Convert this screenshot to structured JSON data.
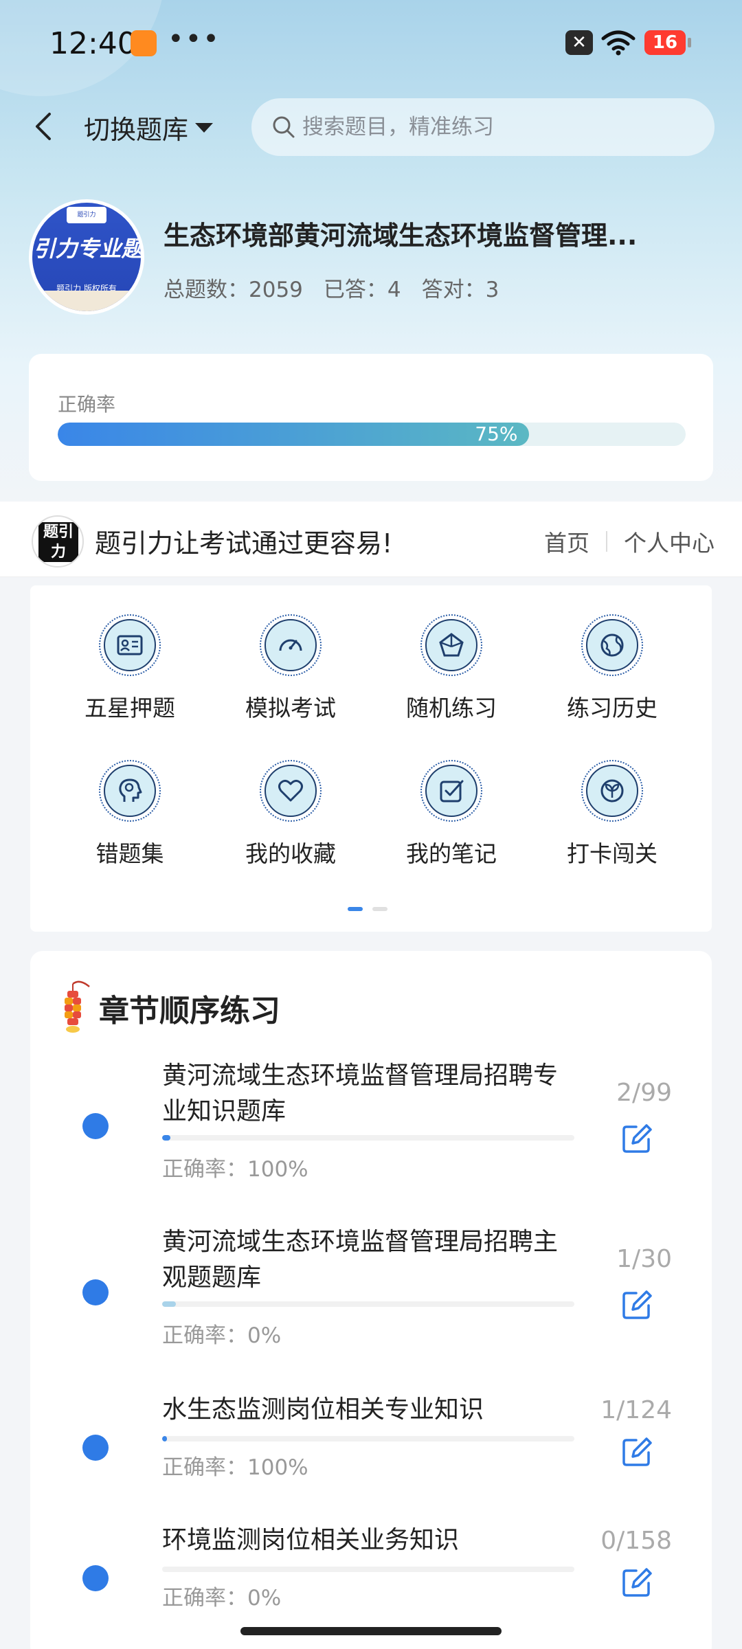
{
  "status_bar": {
    "time": "12:40",
    "battery": "16"
  },
  "header": {
    "switch_label": "切换题库",
    "search_placeholder": "搜索题目，精准练习"
  },
  "bank": {
    "logo_text": "引力专业题",
    "logo_top": "题引力",
    "logo_sub": "题引力 版权所有",
    "title": "生态环境部黄河流域生态环境监督管理...",
    "total_label": "总题数：",
    "total": "2059",
    "answered_label": "已答：",
    "answered": "4",
    "correct_label": "答对：",
    "correct": "3"
  },
  "accuracy": {
    "label": "正确率",
    "value_text": "75%",
    "value": 0.75
  },
  "banner": {
    "slogan": "题引力让考试通过更容易!",
    "logo_text": "题引力",
    "nav": [
      "首页",
      "个人中心"
    ]
  },
  "features": [
    {
      "label": "五星押题",
      "icon": "id-card-icon"
    },
    {
      "label": "模拟考试",
      "icon": "gauge-icon"
    },
    {
      "label": "随机练习",
      "icon": "network-icon"
    },
    {
      "label": "练习历史",
      "icon": "globe-icon"
    },
    {
      "label": "错题集",
      "icon": "head-icon"
    },
    {
      "label": "我的收藏",
      "icon": "heart-icon"
    },
    {
      "label": "我的笔记",
      "icon": "checkbox-icon"
    },
    {
      "label": "打卡闯关",
      "icon": "sprout-icon"
    }
  ],
  "chapters": {
    "title": "章节顺序练习",
    "items": [
      {
        "name": "黄河流域生态环境监督管理局招聘专业知识题库",
        "accuracy": "正确率：100%",
        "progress": "2/99",
        "fraction": 0.02
      },
      {
        "name": "黄河流域生态环境监督管理局招聘主观题题库",
        "accuracy": "正确率：0%",
        "progress": "1/30",
        "fraction": 0.033
      },
      {
        "name": "水生态监测岗位相关专业知识",
        "accuracy": "正确率：100%",
        "progress": "1/124",
        "fraction": 0.008
      },
      {
        "name": "环境监测岗位相关业务知识",
        "accuracy": "正确率：0%",
        "progress": "0/158",
        "fraction": 0
      }
    ]
  },
  "colors": {
    "accent": "#3a86e8",
    "teal": "#5bb8c3",
    "dot": "#2f7be6"
  }
}
